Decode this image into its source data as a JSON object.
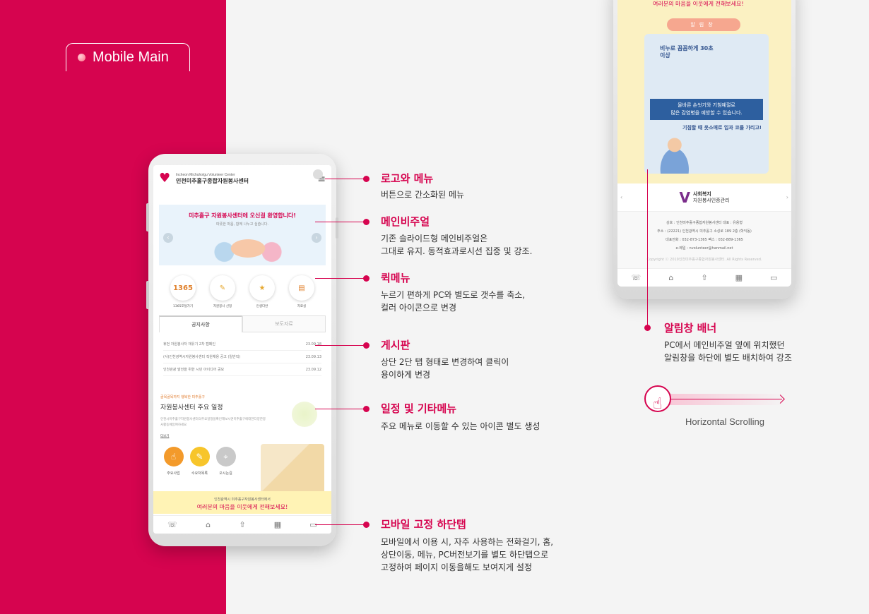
{
  "badge": {
    "label": "Mobile Main"
  },
  "phone": {
    "logo_en": "Incheon Michuholgu Volunteer Center",
    "logo_ko": "인천미추홀구종합자원봉사센터",
    "visual_title": "미추홀구 자원봉사센터에 오신걸 환영합니다!",
    "visual_sub": "따뜻한 마음, 함께 나누고 싶습니다.",
    "quick": [
      {
        "icon_text": "1365",
        "label": "1365포털가기"
      },
      {
        "icon_text": "✎",
        "label": "자원봉사 신청"
      },
      {
        "icon_text": "★",
        "label": "인생다반"
      },
      {
        "icon_text": "▤",
        "label": "자료실"
      }
    ],
    "tabs": [
      "공지사항",
      "보도자료"
    ],
    "board": [
      {
        "title": "휴먼 자원봉사자 재유기 2차 캠페인",
        "date": "23.09.18"
      },
      {
        "title": "(사)인천광역시자원봉사센터 직원채용 공고 (일반직)",
        "date": "23.09.13"
      },
      {
        "title": "인천관광 발전을 위한 시민 아이디어 공모",
        "date": "23.09.12"
      }
    ],
    "sched_kicker": "골목골목까지 행복한 미추홀구",
    "sched_title": "자원봉사센터 주요 일정",
    "sched_desc": "인천시미추홀구자원봉사센터의주요일정을확인해보시면미추홀구에대한다양한봉사활동에참여하세요",
    "sched_more": "더보기",
    "sched_icons": [
      {
        "label": "주요사업",
        "color": "#f39a2b",
        "glyph": "☝"
      },
      {
        "label": "수요처목록",
        "color": "#f7c52b",
        "glyph": "✎"
      },
      {
        "label": "오시는길",
        "color": "#c9c9c9",
        "glyph": "⌖"
      }
    ],
    "banner_1": "인천광역시 미추홀구자원봉사센터에서",
    "banner_2": "여러분의 마음을 이웃에게 전해보세요!",
    "bottom_tabs": [
      "☏",
      "⌂",
      "⇧",
      "▦",
      "▭"
    ]
  },
  "callouts": [
    {
      "title": "로고와 메뉴",
      "desc": [
        "버튼으로 간소화된 메뉴"
      ]
    },
    {
      "title": "메인비주얼",
      "desc": [
        "기존 슬라이드형 메인비주얼은",
        "그대로 유지. 동적효과로시선 집중 및 강조."
      ]
    },
    {
      "title": "퀵메뉴",
      "desc": [
        "누르기 편하게 PC와 별도로 갯수를 축소,",
        "컬러 아이콘으로 변경"
      ]
    },
    {
      "title": "게시판",
      "desc": [
        "상단 2단 탭 형태로 변경하여 클릭이",
        "용이하게 변경"
      ]
    },
    {
      "title": "일정 및 기타메뉴",
      "desc": [
        "주요 메뉴로 이동할 수 있는 아이콘 별도 생성"
      ]
    },
    {
      "title": "모바일 고정 하단탭",
      "desc": [
        "모바일에서 이용 시, 자주 사용하는 전화걸기, 홈,",
        "상단이동, 메뉴, PC버전보기를 별도 하단탭으로",
        "고정하여 페이지 이동을해도 보여지게 설정"
      ]
    },
    {
      "title": "알림창 배너",
      "desc": [
        "PC에서 메인비주얼 옆에 위치했던",
        "알림창을 하단에 별도 배치하여 강조"
      ]
    }
  ],
  "phone2": {
    "hint": "여러분의 마음을 이웃에게 전해보세요!",
    "pill": "알림창",
    "poster_h": "비누로 꼼꼼하게 30초 이상",
    "poster_blue_1": "올바른 손씻기와 기침예절로",
    "poster_blue_2": "많은 감염병을 예방할 수 있습니다.",
    "poster_t2": "기침할 때 옷소매로 입과 코를 가리고!",
    "cert_1": "사회복지",
    "cert_2": "자원봉사인증관리",
    "foot": [
      "상호 : 인천미추홀구종합자원봉사센터 대표 : 유용형",
      "주소 : (22221) 인천광역시 미추홀구 소성로 189 2층 (학익동)",
      "대표전화 : 032-873-1365 팩스 : 032-889-1365",
      "e-메일 : nvolunteer@hanmail.net"
    ],
    "copy": "Copyright ⓒ 2019인천미추홀구종합자원봉사센터. All Rights Reserved.",
    "bottom_tabs": [
      "☏",
      "⌂",
      "⇧",
      "▦",
      "▭"
    ]
  },
  "scroll_label": "Horizontal Scrolling"
}
